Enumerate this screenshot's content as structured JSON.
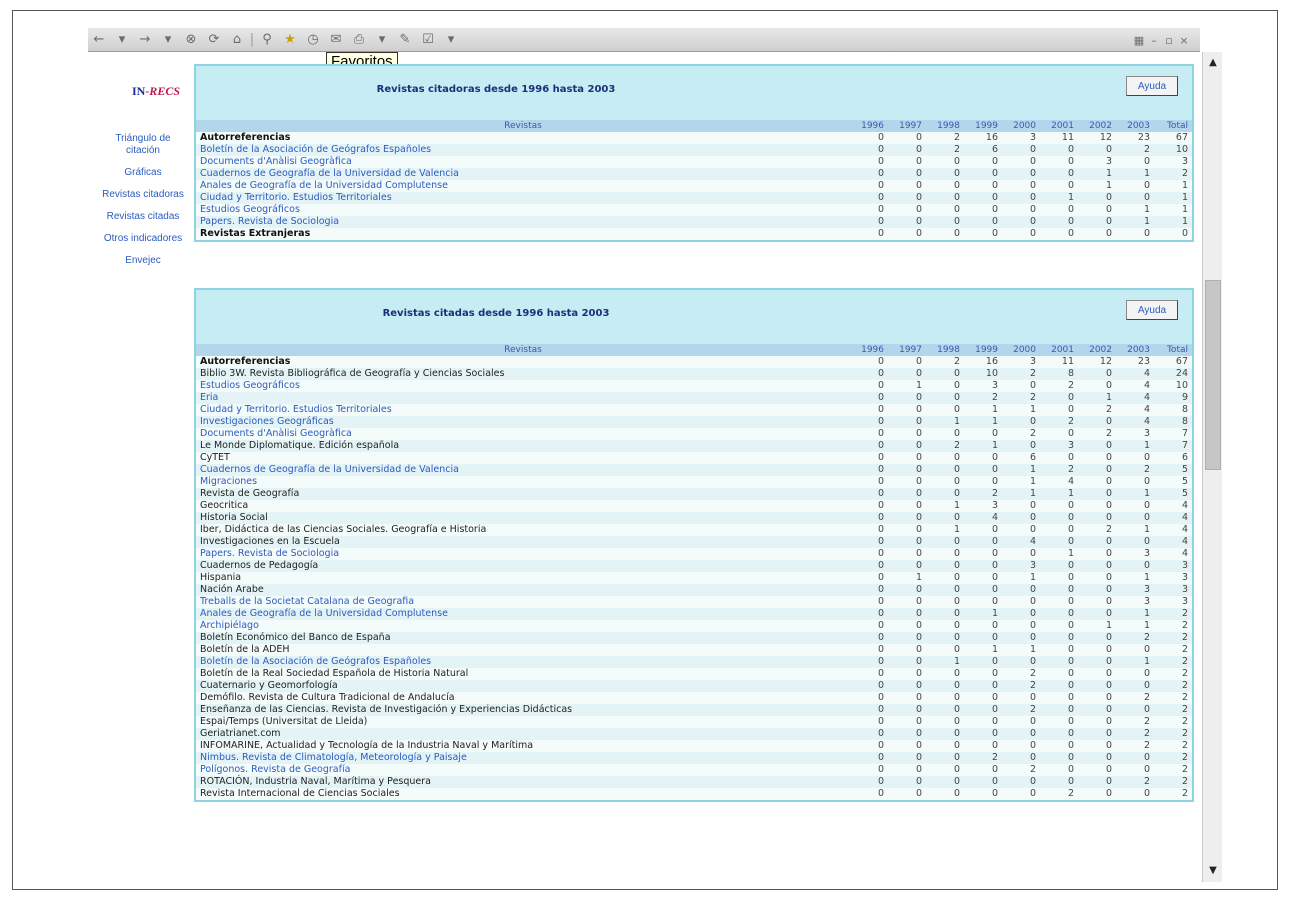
{
  "toolbar": {
    "tooltip": "Favoritos",
    "icons": [
      "back-icon",
      "dropdown-icon",
      "forward-icon",
      "dropdown-icon",
      "stop-icon",
      "refresh-icon",
      "home-icon",
      "search-icon",
      "favorites-icon",
      "history-icon",
      "mail-icon",
      "print-icon",
      "edit-icon",
      "discuss-icon"
    ]
  },
  "sidebar": {
    "logo_in": "IN",
    "logo_rest": "-RECS",
    "links": [
      "Triángulo de citación",
      "Gráficas",
      "Revistas citadoras",
      "Revistas citadas",
      "Otros indicadores",
      "Envejec"
    ]
  },
  "panel1": {
    "title": "Revistas citadoras desde 1996 hasta 2003",
    "help": "Ayuda",
    "headers": [
      "Revistas",
      "1996",
      "1997",
      "1998",
      "1999",
      "2000",
      "2001",
      "2002",
      "2003",
      "Total"
    ],
    "rows": [
      {
        "name": "Autorreferencias",
        "style": "bold",
        "values": [
          "0",
          "0",
          "2",
          "16",
          "3",
          "11",
          "12",
          "23",
          "67"
        ]
      },
      {
        "name": "Boletín de la Asociación de Geógrafos Españoles",
        "style": "link",
        "values": [
          "0",
          "0",
          "2",
          "6",
          "0",
          "0",
          "0",
          "2",
          "10"
        ]
      },
      {
        "name": "Documents d'Anàlisi Geogràfica",
        "style": "link",
        "values": [
          "0",
          "0",
          "0",
          "0",
          "0",
          "0",
          "3",
          "0",
          "3"
        ]
      },
      {
        "name": "Cuadernos de Geografía de la Universidad de Valencia",
        "style": "link",
        "values": [
          "0",
          "0",
          "0",
          "0",
          "0",
          "0",
          "1",
          "1",
          "2"
        ]
      },
      {
        "name": "Anales de Geografía de la Universidad Complutense",
        "style": "link",
        "values": [
          "0",
          "0",
          "0",
          "0",
          "0",
          "0",
          "1",
          "0",
          "1"
        ]
      },
      {
        "name": "Ciudad y Territorio. Estudios Territoriales",
        "style": "link",
        "values": [
          "0",
          "0",
          "0",
          "0",
          "0",
          "1",
          "0",
          "0",
          "1"
        ]
      },
      {
        "name": "Estudios Geográficos",
        "style": "link",
        "values": [
          "0",
          "0",
          "0",
          "0",
          "0",
          "0",
          "0",
          "1",
          "1"
        ]
      },
      {
        "name": "Papers. Revista de Sociologia",
        "style": "link",
        "values": [
          "0",
          "0",
          "0",
          "0",
          "0",
          "0",
          "0",
          "1",
          "1"
        ]
      },
      {
        "name": "Revistas Extranjeras",
        "style": "bold",
        "values": [
          "0",
          "0",
          "0",
          "0",
          "0",
          "0",
          "0",
          "0",
          "0"
        ]
      }
    ]
  },
  "panel2": {
    "title": "Revistas citadas desde 1996 hasta 2003",
    "help": "Ayuda",
    "headers": [
      "Revistas",
      "1996",
      "1997",
      "1998",
      "1999",
      "2000",
      "2001",
      "2002",
      "2003",
      "Total"
    ],
    "rows": [
      {
        "name": "Autorreferencias",
        "style": "bold",
        "values": [
          "0",
          "0",
          "2",
          "16",
          "3",
          "11",
          "12",
          "23",
          "67"
        ]
      },
      {
        "name": "Biblio 3W. Revista Bibliográfica de Geografía y Ciencias Sociales",
        "style": "plain",
        "values": [
          "0",
          "0",
          "0",
          "10",
          "2",
          "8",
          "0",
          "4",
          "24"
        ]
      },
      {
        "name": "Estudios Geográficos",
        "style": "link",
        "values": [
          "0",
          "1",
          "0",
          "3",
          "0",
          "2",
          "0",
          "4",
          "10"
        ]
      },
      {
        "name": "Eria",
        "style": "link",
        "values": [
          "0",
          "0",
          "0",
          "2",
          "2",
          "0",
          "1",
          "4",
          "9"
        ]
      },
      {
        "name": "Ciudad y Territorio. Estudios Territoriales",
        "style": "link",
        "values": [
          "0",
          "0",
          "0",
          "1",
          "1",
          "0",
          "2",
          "4",
          "8"
        ]
      },
      {
        "name": "Investigaciones Geográficas",
        "style": "link",
        "values": [
          "0",
          "0",
          "1",
          "1",
          "0",
          "2",
          "0",
          "4",
          "8"
        ]
      },
      {
        "name": "Documents d'Anàlisi Geogràfica",
        "style": "link",
        "values": [
          "0",
          "0",
          "0",
          "0",
          "2",
          "0",
          "2",
          "3",
          "7"
        ]
      },
      {
        "name": "Le Monde Diplomatique. Edición española",
        "style": "plain",
        "values": [
          "0",
          "0",
          "2",
          "1",
          "0",
          "3",
          "0",
          "1",
          "7"
        ]
      },
      {
        "name": "CyTET",
        "style": "plain",
        "values": [
          "0",
          "0",
          "0",
          "0",
          "6",
          "0",
          "0",
          "0",
          "6"
        ]
      },
      {
        "name": "Cuadernos de Geografía de la Universidad de Valencia",
        "style": "link",
        "values": [
          "0",
          "0",
          "0",
          "0",
          "1",
          "2",
          "0",
          "2",
          "5"
        ]
      },
      {
        "name": "Migraciones",
        "style": "link",
        "values": [
          "0",
          "0",
          "0",
          "0",
          "1",
          "4",
          "0",
          "0",
          "5"
        ]
      },
      {
        "name": "Revista de Geografía",
        "style": "plain",
        "values": [
          "0",
          "0",
          "0",
          "2",
          "1",
          "1",
          "0",
          "1",
          "5"
        ]
      },
      {
        "name": "Geocritica",
        "style": "plain",
        "values": [
          "0",
          "0",
          "1",
          "3",
          "0",
          "0",
          "0",
          "0",
          "4"
        ]
      },
      {
        "name": "Historia Social",
        "style": "plain",
        "values": [
          "0",
          "0",
          "0",
          "4",
          "0",
          "0",
          "0",
          "0",
          "4"
        ]
      },
      {
        "name": "Iber, Didáctica de las Ciencias Sociales. Geografía e Historia",
        "style": "plain",
        "values": [
          "0",
          "0",
          "1",
          "0",
          "0",
          "0",
          "2",
          "1",
          "4"
        ]
      },
      {
        "name": "Investigaciones en la Escuela",
        "style": "plain",
        "values": [
          "0",
          "0",
          "0",
          "0",
          "4",
          "0",
          "0",
          "0",
          "4"
        ]
      },
      {
        "name": "Papers. Revista de Sociologia",
        "style": "link",
        "values": [
          "0",
          "0",
          "0",
          "0",
          "0",
          "1",
          "0",
          "3",
          "4"
        ]
      },
      {
        "name": "Cuadernos de Pedagogía",
        "style": "plain",
        "values": [
          "0",
          "0",
          "0",
          "0",
          "3",
          "0",
          "0",
          "0",
          "3"
        ]
      },
      {
        "name": "Hispania",
        "style": "plain",
        "values": [
          "0",
          "1",
          "0",
          "0",
          "1",
          "0",
          "0",
          "1",
          "3"
        ]
      },
      {
        "name": "Nación Arabe",
        "style": "plain",
        "values": [
          "0",
          "0",
          "0",
          "0",
          "0",
          "0",
          "0",
          "3",
          "3"
        ]
      },
      {
        "name": "Treballs de la Societat Catalana de Geografia",
        "style": "link",
        "values": [
          "0",
          "0",
          "0",
          "0",
          "0",
          "0",
          "0",
          "3",
          "3"
        ]
      },
      {
        "name": "Anales de Geografía de la Universidad Complutense",
        "style": "link",
        "values": [
          "0",
          "0",
          "0",
          "1",
          "0",
          "0",
          "0",
          "1",
          "2"
        ]
      },
      {
        "name": "Archipiélago",
        "style": "link",
        "values": [
          "0",
          "0",
          "0",
          "0",
          "0",
          "0",
          "1",
          "1",
          "2"
        ]
      },
      {
        "name": "Boletín Económico del Banco de España",
        "style": "plain",
        "values": [
          "0",
          "0",
          "0",
          "0",
          "0",
          "0",
          "0",
          "2",
          "2"
        ]
      },
      {
        "name": "Boletín de la ADEH",
        "style": "plain",
        "values": [
          "0",
          "0",
          "0",
          "1",
          "1",
          "0",
          "0",
          "0",
          "2"
        ]
      },
      {
        "name": "Boletín de la Asociación de Geógrafos Españoles",
        "style": "link",
        "values": [
          "0",
          "0",
          "1",
          "0",
          "0",
          "0",
          "0",
          "1",
          "2"
        ]
      },
      {
        "name": "Boletín de la Real Sociedad Española de Historia Natural",
        "style": "plain",
        "values": [
          "0",
          "0",
          "0",
          "0",
          "2",
          "0",
          "0",
          "0",
          "2"
        ]
      },
      {
        "name": "Cuaternario y Geomorfología",
        "style": "plain",
        "values": [
          "0",
          "0",
          "0",
          "0",
          "2",
          "0",
          "0",
          "0",
          "2"
        ]
      },
      {
        "name": "Demófilo. Revista de Cultura Tradicional de Andalucía",
        "style": "plain",
        "values": [
          "0",
          "0",
          "0",
          "0",
          "0",
          "0",
          "0",
          "2",
          "2"
        ]
      },
      {
        "name": "Enseñanza de las Ciencias. Revista de Investigación y Experiencias Didácticas",
        "style": "plain",
        "values": [
          "0",
          "0",
          "0",
          "0",
          "2",
          "0",
          "0",
          "0",
          "2"
        ]
      },
      {
        "name": "Espai/Temps (Universitat de Lleida)",
        "style": "plain",
        "values": [
          "0",
          "0",
          "0",
          "0",
          "0",
          "0",
          "0",
          "2",
          "2"
        ]
      },
      {
        "name": "Geriatrianet.com",
        "style": "plain",
        "values": [
          "0",
          "0",
          "0",
          "0",
          "0",
          "0",
          "0",
          "2",
          "2"
        ]
      },
      {
        "name": "INFOMARINE, Actualidad y Tecnología de la Industria Naval y Marítima",
        "style": "plain",
        "values": [
          "0",
          "0",
          "0",
          "0",
          "0",
          "0",
          "0",
          "2",
          "2"
        ]
      },
      {
        "name": "Nimbus. Revista de Climatología, Meteorología y Paisaje",
        "style": "link",
        "values": [
          "0",
          "0",
          "0",
          "2",
          "0",
          "0",
          "0",
          "0",
          "2"
        ]
      },
      {
        "name": "Polígonos. Revista de Geografía",
        "style": "link",
        "values": [
          "0",
          "0",
          "0",
          "0",
          "2",
          "0",
          "0",
          "0",
          "2"
        ]
      },
      {
        "name": "ROTACIÓN, Industria Naval, Marítima y Pesquera",
        "style": "plain",
        "values": [
          "0",
          "0",
          "0",
          "0",
          "0",
          "0",
          "0",
          "2",
          "2"
        ]
      },
      {
        "name": "Revista Internacional de Ciencias Sociales",
        "style": "plain",
        "values": [
          "0",
          "0",
          "0",
          "0",
          "0",
          "2",
          "0",
          "0",
          "2"
        ]
      }
    ]
  }
}
